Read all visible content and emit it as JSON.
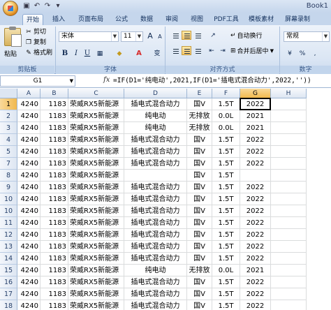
{
  "window": {
    "title": "Book1"
  },
  "ribbon": {
    "tabs": [
      "开始",
      "插入",
      "页面布局",
      "公式",
      "数据",
      "审阅",
      "视图",
      "PDF工具",
      "模板素材",
      "屏幕录制"
    ],
    "active_tab": "开始",
    "clipboard": {
      "paste": "粘贴",
      "cut": "剪切",
      "copy": "复制",
      "format_painter": "格式刷",
      "group": "剪贴板"
    },
    "font": {
      "name": "宋体",
      "size": "11",
      "group": "字体",
      "grow_icon": "A",
      "shrink_icon": "A",
      "font_color_icon": "A",
      "phonetic_icon": "变"
    },
    "alignment": {
      "wrap": "自动换行",
      "merge": "合并后居中",
      "group": "对齐方式"
    },
    "number": {
      "format": "常规",
      "group": "数字"
    }
  },
  "formula_bar": {
    "name_box": "G1",
    "fx": "fx",
    "formula": "=IF(D1='纯电动',2021,IF(D1='插电式混合动力',2022,''))"
  },
  "grid": {
    "columns": [
      "A",
      "B",
      "C",
      "D",
      "E",
      "F",
      "G",
      "H"
    ],
    "selected_column": "G",
    "selected_row": 1,
    "rows": [
      {
        "n": "1",
        "a": "4240",
        "b": "1183",
        "c": "荣威RX5新能源",
        "d": "插电式混合动力",
        "e": "国V",
        "f": "1.5T",
        "g": "2022"
      },
      {
        "n": "2",
        "a": "4240",
        "b": "1183",
        "c": "荣威RX5新能源",
        "d": "纯电动",
        "e": "无排放",
        "f": "0.0L",
        "g": "2021"
      },
      {
        "n": "3",
        "a": "4240",
        "b": "1183",
        "c": "荣威RX5新能源",
        "d": "纯电动",
        "e": "无排放",
        "f": "0.0L",
        "g": "2021"
      },
      {
        "n": "4",
        "a": "4240",
        "b": "1183",
        "c": "荣威RX5新能源",
        "d": "插电式混合动力",
        "e": "国V",
        "f": "1.5T",
        "g": "2022"
      },
      {
        "n": "5",
        "a": "4240",
        "b": "1183",
        "c": "荣威RX5新能源",
        "d": "插电式混合动力",
        "e": "国V",
        "f": "1.5T",
        "g": "2022"
      },
      {
        "n": "7",
        "a": "4240",
        "b": "1183",
        "c": "荣威RX5新能源",
        "d": "插电式混合动力",
        "e": "国V",
        "f": "1.5T",
        "g": "2022"
      },
      {
        "n": "8",
        "a": "4240",
        "b": "1183",
        "c": "荣威RX5新能源",
        "d": "",
        "e": "国V",
        "f": "1.5T",
        "g": ""
      },
      {
        "n": "9",
        "a": "4240",
        "b": "1183",
        "c": "荣威RX5新能源",
        "d": "插电式混合动力",
        "e": "国V",
        "f": "1.5T",
        "g": "2022"
      },
      {
        "n": "10",
        "a": "4240",
        "b": "1183",
        "c": "荣威RX5新能源",
        "d": "插电式混合动力",
        "e": "国V",
        "f": "1.5T",
        "g": "2022"
      },
      {
        "n": "10",
        "a": "4240",
        "b": "1183",
        "c": "荣威RX5新能源",
        "d": "插电式混合动力",
        "e": "国V",
        "f": "1.5T",
        "g": "2022"
      },
      {
        "n": "11",
        "a": "4240",
        "b": "1183",
        "c": "荣威RX5新能源",
        "d": "插电式混合动力",
        "e": "国V",
        "f": "1.5T",
        "g": "2022"
      },
      {
        "n": "12",
        "a": "4240",
        "b": "1183",
        "c": "荣威RX5新能源",
        "d": "插电式混合动力",
        "e": "国V",
        "f": "1.5T",
        "g": "2022"
      },
      {
        "n": "13",
        "a": "4240",
        "b": "1183",
        "c": "荣威RX5新能源",
        "d": "插电式混合动力",
        "e": "国V",
        "f": "1.5T",
        "g": "2022"
      },
      {
        "n": "14",
        "a": "4240",
        "b": "1183",
        "c": "荣威RX5新能源",
        "d": "插电式混合动力",
        "e": "国V",
        "f": "1.5T",
        "g": "2022"
      },
      {
        "n": "15",
        "a": "4240",
        "b": "1183",
        "c": "荣威RX5新能源",
        "d": "纯电动",
        "e": "无排放",
        "f": "0.0L",
        "g": "2021"
      },
      {
        "n": "16",
        "a": "4240",
        "b": "1183",
        "c": "荣威RX5新能源",
        "d": "插电式混合动力",
        "e": "国V",
        "f": "1.5T",
        "g": "2022"
      },
      {
        "n": "17",
        "a": "4240",
        "b": "1183",
        "c": "荣威RX5新能源",
        "d": "插电式混合动力",
        "e": "国V",
        "f": "1.5T",
        "g": "2022"
      },
      {
        "n": "18",
        "a": "4240",
        "b": "1183",
        "c": "荣威RX5新能源",
        "d": "插电式混合动力",
        "e": "国V",
        "f": "1.5T",
        "g": "2022"
      }
    ]
  }
}
